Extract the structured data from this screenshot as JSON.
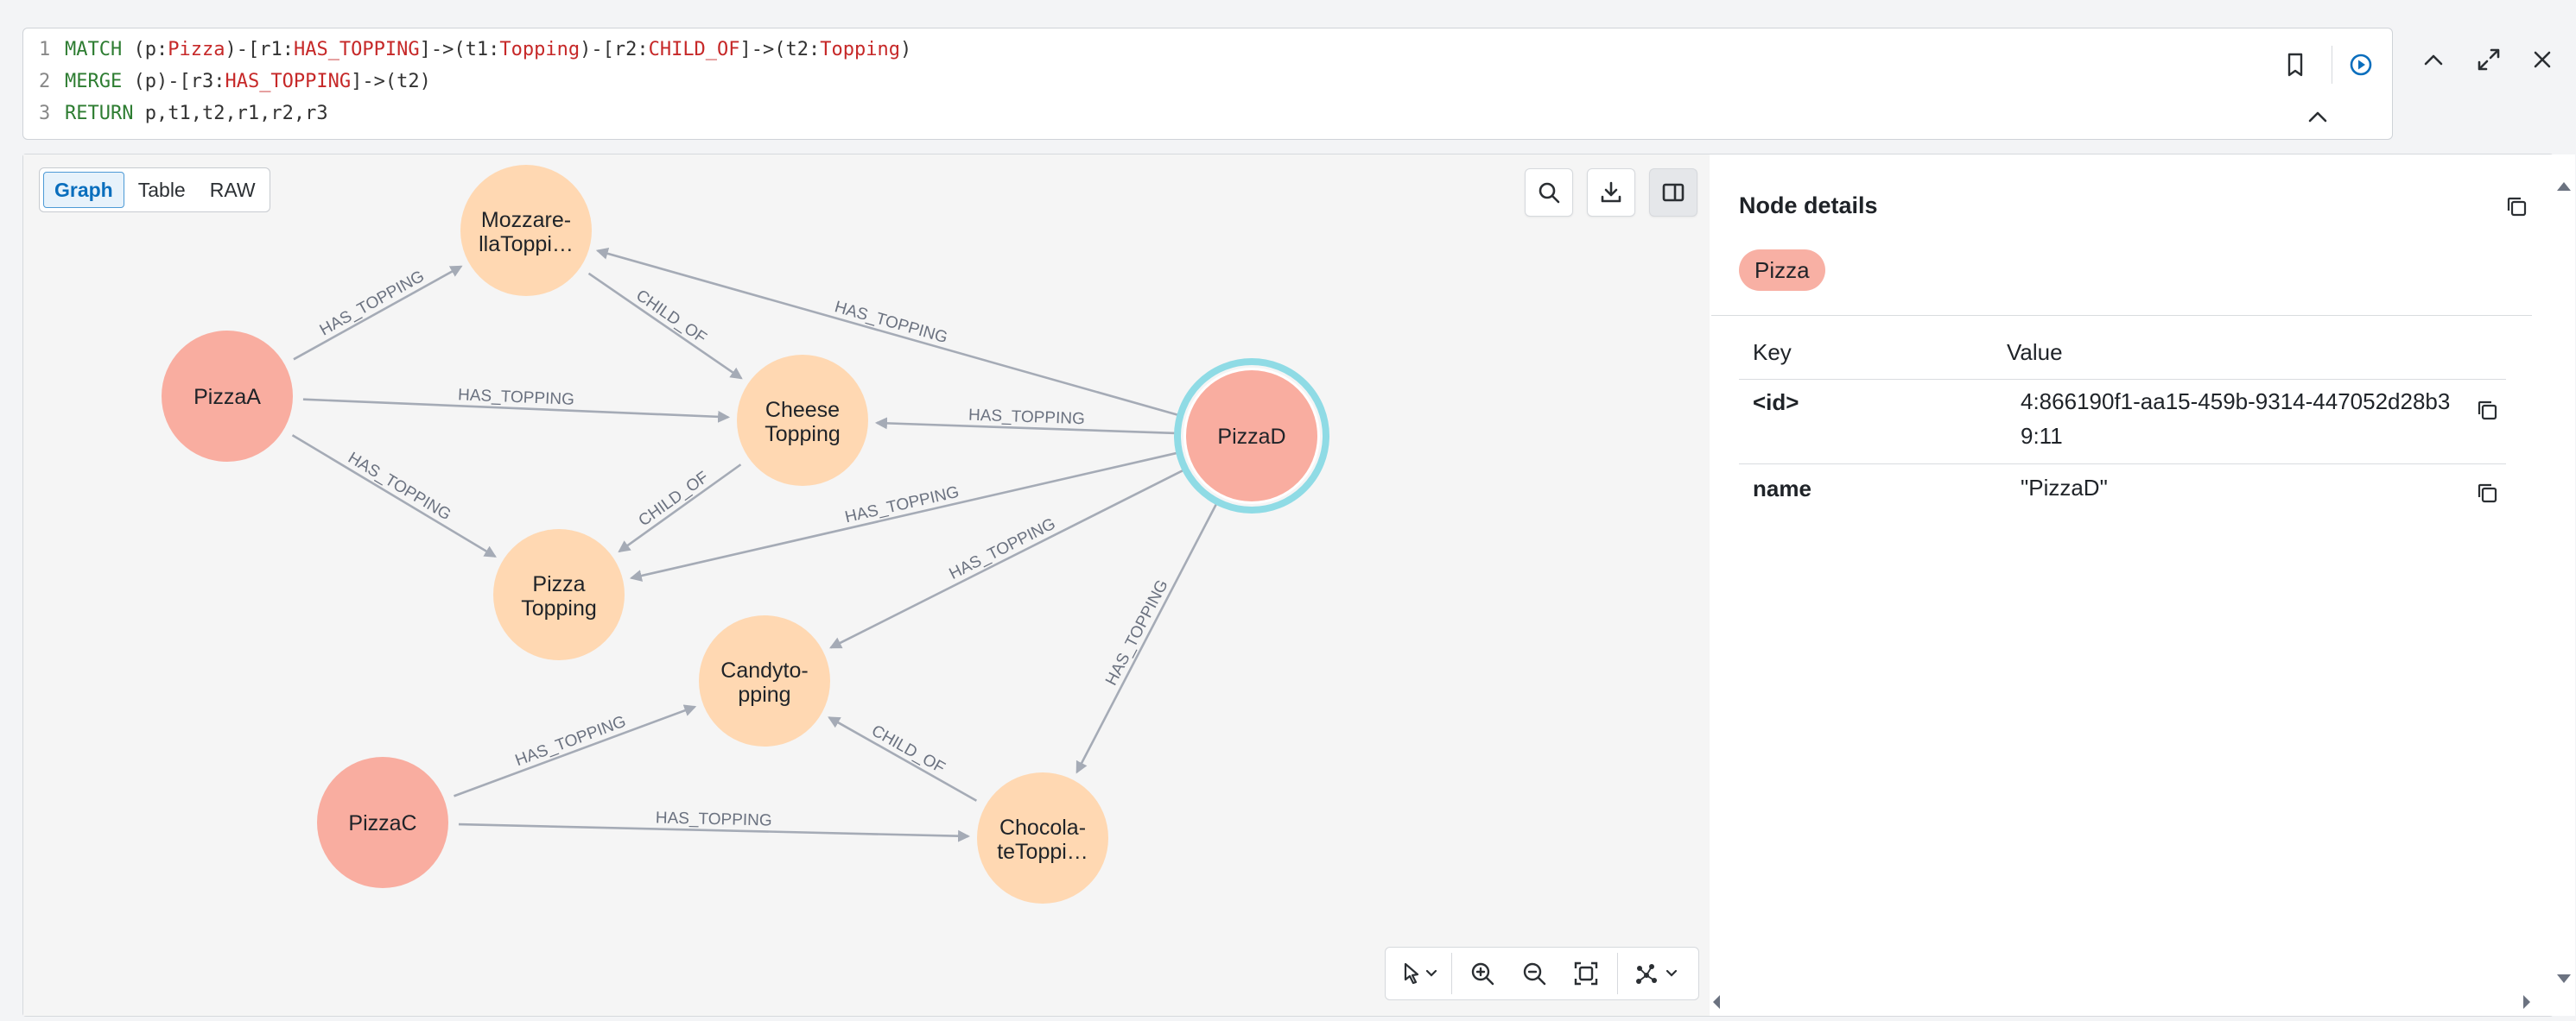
{
  "editor": {
    "lines": [
      {
        "num": "1",
        "tokens": [
          {
            "t": "MATCH ",
            "c": "kw"
          },
          {
            "t": "(p:",
            "c": "punc"
          },
          {
            "t": "Pizza",
            "c": "lbl"
          },
          {
            "t": ")-[r1:",
            "c": "punc"
          },
          {
            "t": "HAS_TOPPING",
            "c": "lbl"
          },
          {
            "t": "]->(t1:",
            "c": "punc"
          },
          {
            "t": "Topping",
            "c": "lbl"
          },
          {
            "t": ")-[r2:",
            "c": "punc"
          },
          {
            "t": "CHILD_OF",
            "c": "lbl"
          },
          {
            "t": "]->(t2:",
            "c": "punc"
          },
          {
            "t": "Topping",
            "c": "lbl"
          },
          {
            "t": ")",
            "c": "punc"
          }
        ]
      },
      {
        "num": "2",
        "tokens": [
          {
            "t": "MERGE ",
            "c": "kw"
          },
          {
            "t": "(p)-[r3:",
            "c": "punc"
          },
          {
            "t": "HAS_TOPPING",
            "c": "lbl"
          },
          {
            "t": "]->(t2)",
            "c": "punc"
          }
        ]
      },
      {
        "num": "3",
        "tokens": [
          {
            "t": "RETURN ",
            "c": "kw"
          },
          {
            "t": "p,t1,t2,r1,r2,r3",
            "c": "punc"
          }
        ]
      }
    ]
  },
  "view_tabs": [
    "Graph",
    "Table",
    "RAW"
  ],
  "active_tab": "Graph",
  "graph": {
    "nodes": [
      {
        "id": "mozz",
        "label1": "Mozzare-",
        "label2": "llaToppi…",
        "kind": "topping"
      },
      {
        "id": "pizzaA",
        "label1": "PizzaA",
        "label2": "",
        "kind": "pizza"
      },
      {
        "id": "cheese",
        "label1": "Cheese",
        "label2": "Topping",
        "kind": "topping"
      },
      {
        "id": "pizzaTop",
        "label1": "Pizza",
        "label2": "Topping",
        "kind": "topping"
      },
      {
        "id": "pizzaD",
        "label1": "PizzaD",
        "label2": "",
        "kind": "pizza",
        "selected": true
      },
      {
        "id": "candy",
        "label1": "Candyto-",
        "label2": "pping",
        "kind": "topping"
      },
      {
        "id": "pizzaC",
        "label1": "PizzaC",
        "label2": "",
        "kind": "pizza"
      },
      {
        "id": "choc",
        "label1": "Chocola-",
        "label2": "teToppi…",
        "kind": "topping"
      }
    ],
    "edges": [
      {
        "from": "pizzaA",
        "to": "mozz",
        "label": "HAS_TOPPING"
      },
      {
        "from": "pizzaA",
        "to": "cheese",
        "label": "HAS_TOPPING"
      },
      {
        "from": "pizzaA",
        "to": "pizzaTop",
        "label": "HAS_TOPPING"
      },
      {
        "from": "mozz",
        "to": "cheese",
        "label": "CHILD_OF"
      },
      {
        "from": "cheese",
        "to": "pizzaTop",
        "label": "CHILD_OF"
      },
      {
        "from": "pizzaD",
        "to": "mozz",
        "label": "HAS_TOPPING"
      },
      {
        "from": "pizzaD",
        "to": "cheese",
        "label": "HAS_TOPPING"
      },
      {
        "from": "pizzaD",
        "to": "pizzaTop",
        "label": "HAS_TOPPING"
      },
      {
        "from": "pizzaD",
        "to": "candy",
        "label": "HAS_TOPPING"
      },
      {
        "from": "pizzaD",
        "to": "choc",
        "label": "HAS_TOPPING"
      },
      {
        "from": "pizzaC",
        "to": "candy",
        "label": "HAS_TOPPING"
      },
      {
        "from": "pizzaC",
        "to": "choc",
        "label": "HAS_TOPPING"
      },
      {
        "from": "choc",
        "to": "candy",
        "label": "CHILD_OF"
      }
    ],
    "colors": {
      "pizza": "#f9ada0",
      "topping": "#ffd8b2",
      "edge": "#a5abb6",
      "edge_label": "#6b7280",
      "selected_ring": "#8fdbe5"
    }
  },
  "details": {
    "title": "Node details",
    "label": "Pizza",
    "col_key": "Key",
    "col_value": "Value",
    "rows": [
      {
        "key": "<id>",
        "value": "4:866190f1-aa15-459b-9314-447052d28b39:11"
      },
      {
        "key": "name",
        "value": "\"PizzaD\""
      }
    ]
  }
}
